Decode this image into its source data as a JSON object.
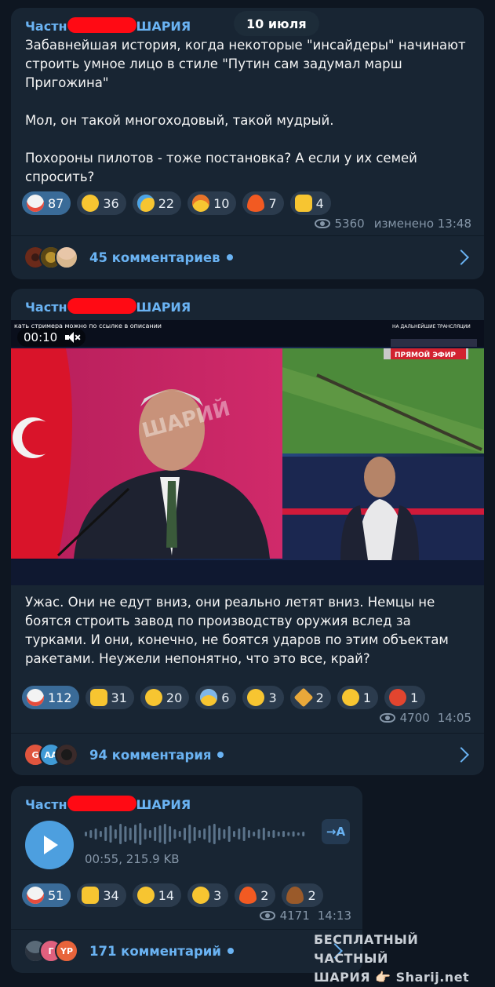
{
  "date_badge": "10 июля",
  "messages": [
    {
      "sender_prefix": "Частн",
      "sender_suffix": "ШАРИЯ",
      "text": "Забавнейшая история, когда некоторые \"инсайдеры\" начинают строить умное лицо в стиле \"Путин сам задумал марш Пригожина\"\n\nМол, он такой многоходовый, такой мудрый.\n\nПохороны пилотов - тоже постановка? А если у их семей спросить?",
      "reactions": [
        {
          "emoji": "clown",
          "count": "87"
        },
        {
          "emoji": "grin",
          "count": "36"
        },
        {
          "emoji": "cry",
          "count": "22"
        },
        {
          "emoji": "exploding-head",
          "count": "10"
        },
        {
          "emoji": "fire",
          "count": "7"
        },
        {
          "emoji": "thumbs-up",
          "count": "4"
        }
      ],
      "views": "5360",
      "time": "изменено 13:48",
      "comments": "45 комментариев"
    },
    {
      "sender_prefix": "Частн",
      "sender_suffix": "ШАРИЯ",
      "video": {
        "duration": "00:10",
        "ticker": "кать стримера можно по ссылке в описании",
        "live_label": "ПРЯМОЙ ЭФИР",
        "top_label": "НА ДАЛЬНЕЙШИЕ ТРАНСЛЯЦИИ",
        "watermark": "ШАРИЙ"
      },
      "text": "Ужас. Они не едут вниз, они реально летят вниз. Немцы не боятся строить завод по производству оружия вслед за турками. И они, конечно, не боятся ударов по этим объектам ракетами. Неужели непонятно, что это все, край?",
      "reactions": [
        {
          "emoji": "clown",
          "count": "112"
        },
        {
          "emoji": "thumbs-up",
          "count": "31"
        },
        {
          "emoji": "grin",
          "count": "20"
        },
        {
          "emoji": "scream",
          "count": "6"
        },
        {
          "emoji": "yawn",
          "count": "3"
        },
        {
          "emoji": "party",
          "count": "2"
        },
        {
          "emoji": "thinking",
          "count": "1"
        },
        {
          "emoji": "cursing",
          "count": "1"
        }
      ],
      "views": "4700",
      "time": "14:05",
      "comments": "94 комментария",
      "avatars": [
        "G",
        "AA",
        ""
      ]
    },
    {
      "sender_prefix": "Частн",
      "sender_suffix": "ШАРИЯ",
      "voice": {
        "duration": "00:55, 215.9 KB",
        "transcribe": "→A"
      },
      "reactions": [
        {
          "emoji": "clown",
          "count": "51"
        },
        {
          "emoji": "thumbs-up",
          "count": "34"
        },
        {
          "emoji": "grin",
          "count": "14"
        },
        {
          "emoji": "yawn",
          "count": "3"
        },
        {
          "emoji": "fire",
          "count": "2"
        },
        {
          "emoji": "poop",
          "count": "2"
        }
      ],
      "views": "4171",
      "time": "14:13",
      "comments": "171 комментарий",
      "avatars": [
        "",
        "Г",
        "YP"
      ]
    }
  ],
  "watermark": {
    "line1": "БЕСПЛАТНЫЙ ЧАСТНЫЙ",
    "line2": "ШАРИЯ 👉🏻 Sharij.net"
  }
}
